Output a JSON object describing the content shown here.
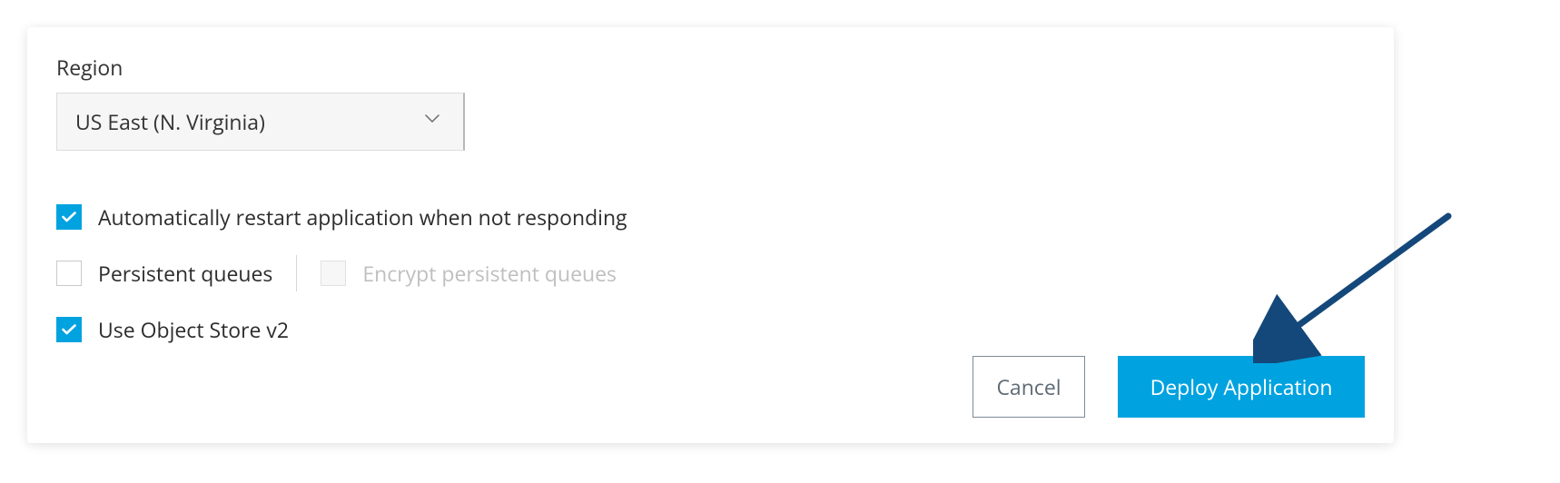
{
  "region": {
    "label": "Region",
    "selected": "US East (N. Virginia)"
  },
  "options": {
    "auto_restart": {
      "label": "Automatically restart application when not responding",
      "checked": true
    },
    "persistent_queues": {
      "label": "Persistent queues",
      "checked": false
    },
    "encrypt_persistent_queues": {
      "label": "Encrypt persistent queues",
      "checked": false,
      "disabled": true
    },
    "object_store_v2": {
      "label": "Use Object Store v2",
      "checked": true
    }
  },
  "buttons": {
    "cancel": "Cancel",
    "deploy": "Deploy Application"
  },
  "colors": {
    "accent": "#00a2df",
    "arrow": "#14487a"
  }
}
